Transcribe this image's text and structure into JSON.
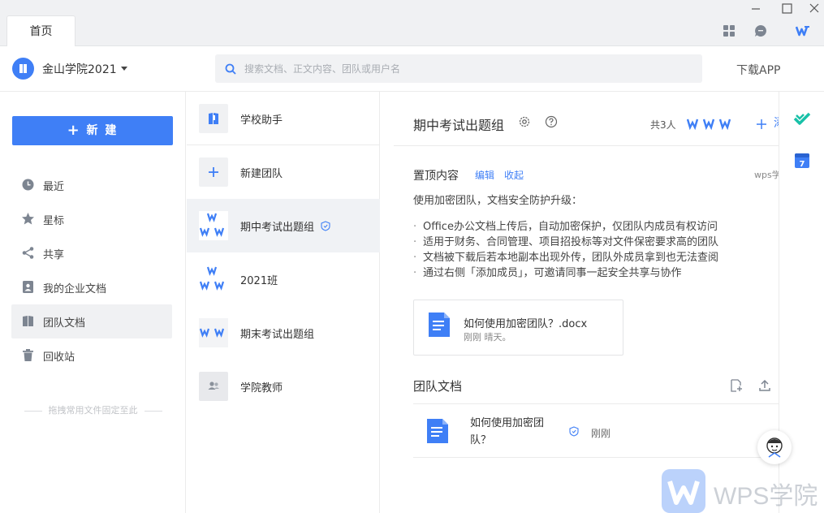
{
  "tabs": [
    {
      "label": "首页"
    }
  ],
  "header": {
    "account_name": "金山学院2021",
    "search_placeholder": "搜索文档、正文内容、团队或用户名",
    "download_app": "下载APP"
  },
  "sidebar": {
    "new_button": "新 建",
    "items": [
      {
        "label": "最近",
        "icon": "clock-icon"
      },
      {
        "label": "星标",
        "icon": "star-icon"
      },
      {
        "label": "共享",
        "icon": "share-icon"
      },
      {
        "label": "我的企业文档",
        "icon": "person-doc-icon"
      },
      {
        "label": "团队文档",
        "icon": "book-icon",
        "active": true
      },
      {
        "label": "回收站",
        "icon": "trash-icon"
      }
    ],
    "pin_hint": "拖拽常用文件固定至此"
  },
  "teams": [
    {
      "name": "学校助手",
      "avatar": "school-icon"
    },
    {
      "name": "新建团队",
      "avatar": "plus-icon"
    },
    {
      "name": "期中考试出题组",
      "avatar": "wps-group-avatar",
      "active": true,
      "badge": "shield-icon"
    },
    {
      "name": "2021班",
      "avatar": "wps-group-avatar"
    },
    {
      "name": "期末考试出题组",
      "avatar": "wps-group-avatar"
    },
    {
      "name": "学院教师",
      "avatar": "people-icon"
    }
  ],
  "main": {
    "group_title": "期中考试出题组",
    "member_count": "共3人",
    "add_member": "添",
    "pinned": {
      "title": "置顶内容",
      "edit": "编辑",
      "collapse": "收起",
      "wps_label": "wps学",
      "intro": "使用加密团队，文档安全防护升级：",
      "bullets": [
        "Office办公文档上传后，自动加密保护，仅团队内成员有权访问",
        "适用于财务、合同管理、项目招投标等对文件保密要求高的团队",
        "文档被下载后若本地副本出现外传，团队外成员拿到也无法查阅",
        "通过右侧「添加成员」，可邀请同事一起安全共享与协作"
      ],
      "card": {
        "name": "如何使用加密团队？.docx",
        "meta": "刚刚 晴天。"
      }
    },
    "team_docs": {
      "title": "团队文档",
      "rows": [
        {
          "name": "如何使用加密团队？",
          "time": "刚刚"
        }
      ]
    }
  },
  "watermark": "WPS学院",
  "colors": {
    "accent": "#3f7ff6",
    "check_green": "#18c1a8"
  }
}
